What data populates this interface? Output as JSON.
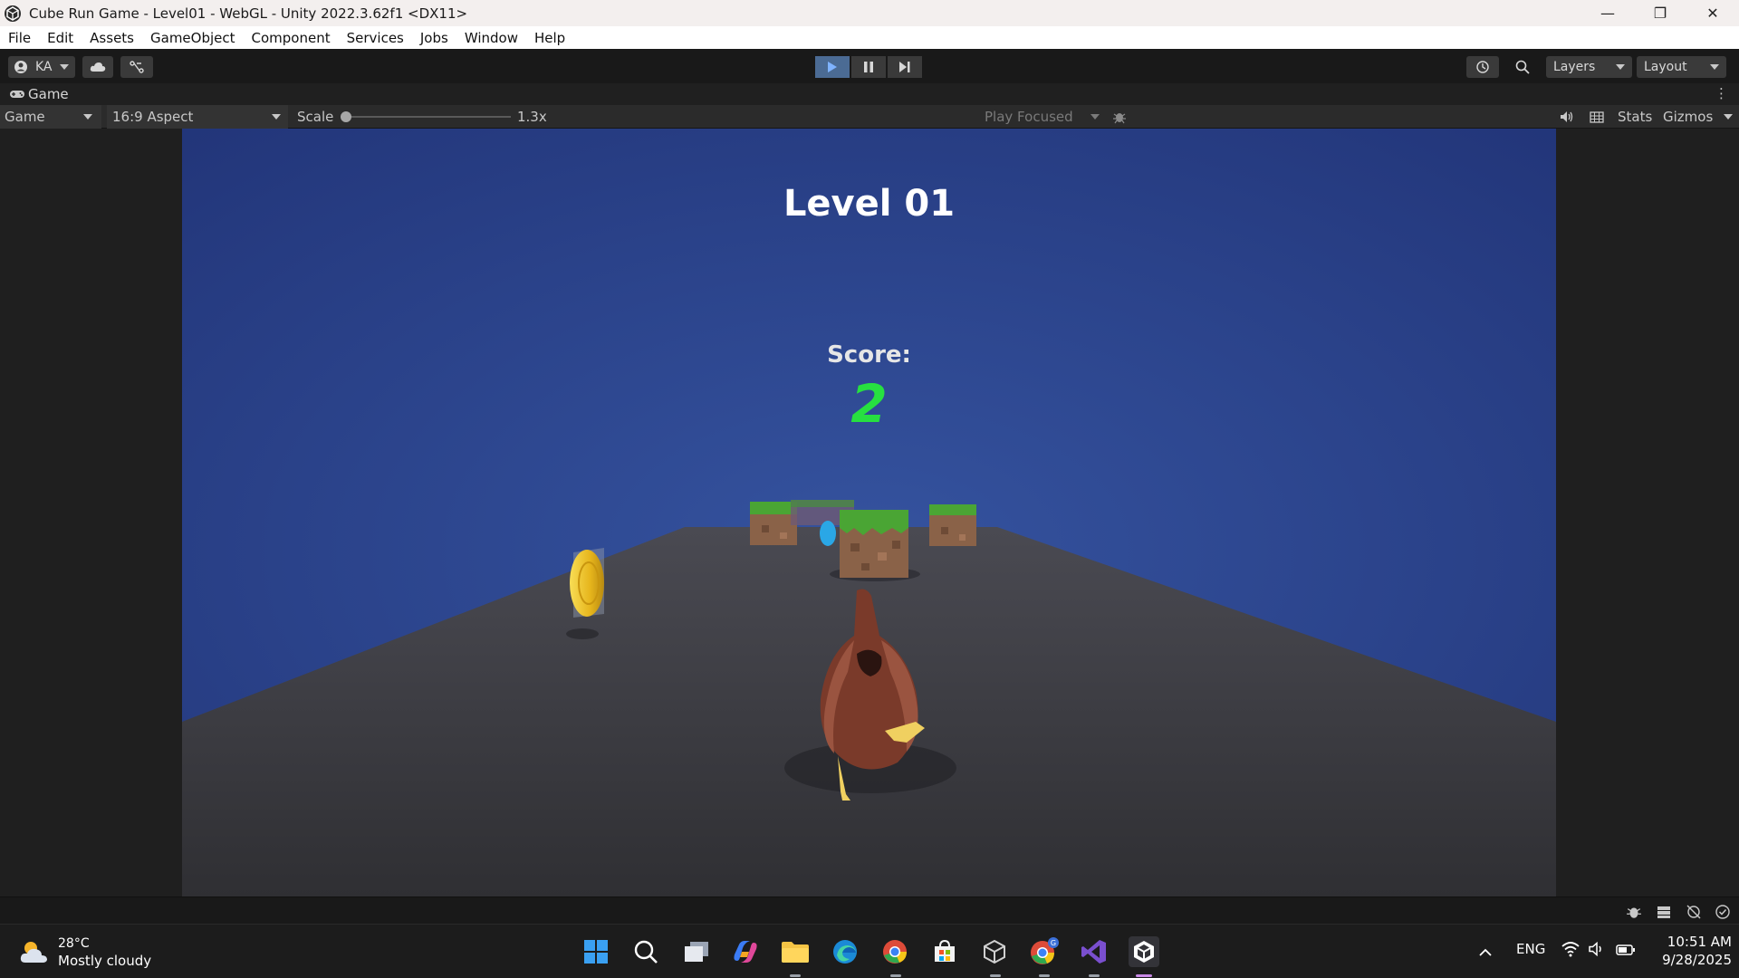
{
  "window": {
    "title": "Cube Run Game - Level01 - WebGL - Unity 2022.3.62f1 <DX11>",
    "controls": {
      "minimize": "—",
      "restore": "❐",
      "close": "✕"
    }
  },
  "menu": [
    "File",
    "Edit",
    "Assets",
    "GameObject",
    "Component",
    "Services",
    "Jobs",
    "Window",
    "Help"
  ],
  "toolbar": {
    "account_label": "KA",
    "layers_label": "Layers",
    "layout_label": "Layout",
    "play_active": true
  },
  "panel": {
    "tab_label": "Game"
  },
  "gamebar": {
    "display": "Game",
    "aspect": "16:9 Aspect",
    "scale_label": "Scale",
    "scale_value": "1.3x",
    "play_mode": "Play Focused",
    "stats_label": "Stats",
    "gizmos_label": "Gizmos"
  },
  "game": {
    "level_title": "Level 01",
    "score_label": "Score:",
    "score_value": "2",
    "colors": {
      "sky": "#2a3f8a",
      "ground": "#3e3e44",
      "score": "#27e040",
      "grass": "#4aa534",
      "dirt": "#8a6248",
      "coin": "#f2c21e",
      "chicken": "#7a3a2a"
    }
  },
  "taskbar": {
    "weather_temp": "28°C",
    "weather_desc": "Mostly cloudy",
    "language": "ENG",
    "time": "10:51 AM",
    "date": "9/28/2025",
    "apps": [
      "start-icon",
      "search-icon",
      "task-view-icon",
      "copilot-icon",
      "file-explorer-icon",
      "edge-icon",
      "chrome-icon",
      "store-icon",
      "unity-hub-icon",
      "chrome-profile-icon",
      "visual-studio-icon",
      "unity-editor-icon"
    ]
  }
}
